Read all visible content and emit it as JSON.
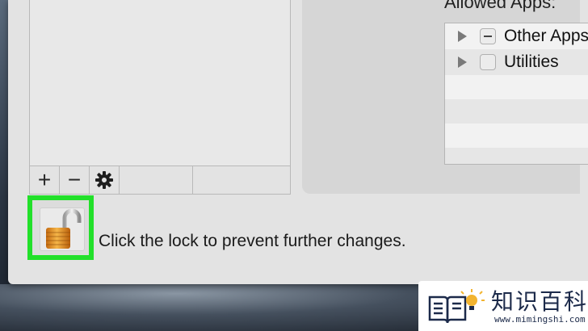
{
  "allowed_apps": {
    "label": "Allowed Apps:",
    "items": [
      {
        "name": "Other Apps",
        "checkbox_state": "mixed"
      },
      {
        "name": "Utilities",
        "checkbox_state": "unchecked"
      }
    ]
  },
  "toolbar": {
    "add_symbol": "+",
    "remove_symbol": "−",
    "action_icon": "gear-icon"
  },
  "lock": {
    "caption": "Click the lock to prevent further changes.",
    "state": "unlocked",
    "highlight_color": "#22e02a"
  },
  "watermark": {
    "brand": "知识百科",
    "url": "www.mimingshi.com"
  }
}
